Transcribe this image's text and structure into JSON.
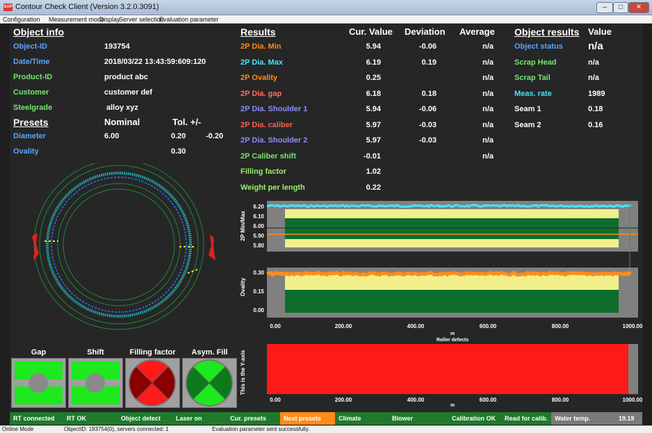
{
  "window": {
    "title": "Contour Check Client (Version 3.2.0.3091)",
    "icon_label": "SAP"
  },
  "menu": [
    "Configuration",
    "Measurement mode",
    "Display",
    "Server selection",
    "Evaluation parameter"
  ],
  "object_info": {
    "heading": "Object info",
    "rows": [
      {
        "label": "Object-ID",
        "value": "193754"
      },
      {
        "label": "Date/Time",
        "value": "2018/03/22 13:43:59:609:120"
      },
      {
        "label": "Product-ID",
        "value": "product abc"
      },
      {
        "label": "Customer",
        "value": "customer def"
      },
      {
        "label": "Steelgrade",
        "value": "alloy xyz"
      }
    ]
  },
  "presets": {
    "heading": "Presets",
    "nominal_label": "Nominal",
    "tol_label": "Tol. +/-",
    "rows": [
      {
        "label": "Diameter",
        "nominal": "6.00",
        "tol_plus": "0.20",
        "tol_minus": "-0.20"
      },
      {
        "label": "Ovality",
        "nominal": "",
        "tol_plus": "0.30",
        "tol_minus": ""
      }
    ]
  },
  "results": {
    "heading": "Results",
    "col_cur": "Cur. Value",
    "col_dev": "Deviation",
    "col_avg": "Average",
    "rows": [
      {
        "label": "2P Dia. Min",
        "cur": "5.94",
        "dev": "-0.06",
        "avg": "n/a",
        "color": "#ff8c1a"
      },
      {
        "label": "2P Dia. Max",
        "cur": "6.19",
        "dev": "0.19",
        "avg": "n/a",
        "color": "#44e6ff"
      },
      {
        "label": "2P Ovality",
        "cur": "0.25",
        "dev": "",
        "avg": "n/a",
        "color": "#ff8c1a"
      },
      {
        "label": "2P Dia. gap",
        "cur": "6.18",
        "dev": "0.18",
        "avg": "n/a",
        "color": "#ff6f5e"
      },
      {
        "label": "2P Dia. Shoulder 1",
        "cur": "5.94",
        "dev": "-0.06",
        "avg": "n/a",
        "color": "#8c8cff"
      },
      {
        "label": "2P Dia. caliber",
        "cur": "5.97",
        "dev": "-0.03",
        "avg": "n/a",
        "color": "#ff5f4a"
      },
      {
        "label": "2P Dia. Shoulder 2",
        "cur": "5.97",
        "dev": "-0.03",
        "avg": "n/a",
        "color": "#8c8cff"
      },
      {
        "label": "2P Caliber shift",
        "cur": "-0.01",
        "dev": "",
        "avg": "n/a",
        "color": "#74e66e"
      },
      {
        "label": "Filling factor",
        "cur": "1.02",
        "dev": "",
        "avg": "",
        "color": "#9cef6e"
      },
      {
        "label": "Weight per length",
        "cur": "0.22",
        "dev": "",
        "avg": "",
        "color": "#9cef6e"
      }
    ]
  },
  "object_results": {
    "heading": "Object results",
    "col_value": "Value",
    "rows": [
      {
        "label": "Object status",
        "value": "n/a",
        "color": "#5aa6ff"
      },
      {
        "label": "Scrap Head",
        "value": "n/a",
        "color": "#74e66e"
      },
      {
        "label": "Scrap Tail",
        "value": "n/a",
        "color": "#74e66e"
      },
      {
        "label": "Meas. rate",
        "value": "1989",
        "color": "#44e6ff"
      },
      {
        "label": "Seam 1",
        "value": "0.18",
        "color": "#ffffff"
      },
      {
        "label": "Seam 2",
        "value": "0.16",
        "color": "#ffffff"
      }
    ]
  },
  "gauges": [
    {
      "label": "Gap",
      "state": "ok"
    },
    {
      "label": "Shift",
      "state": "ok"
    },
    {
      "label": "Filling factor",
      "state": "alarm"
    },
    {
      "label": "Asym. Fill",
      "state": "ok"
    }
  ],
  "charts": {
    "dia": {
      "ylabel": "2P Min/Max",
      "ticks": [
        "6.20",
        "6.10",
        "6.00",
        "5.90",
        "5.80"
      ]
    },
    "ovality": {
      "ylabel": "Ovality",
      "ticks": [
        "0.30",
        "0.15",
        "0.00"
      ]
    },
    "x_ticks": [
      "0.00",
      "200.00",
      "400.00",
      "600.00",
      "800.00",
      "1000.00"
    ],
    "x_unit": "m",
    "roller": {
      "title": "Roller defects",
      "ylabel": "This is the Y-axis",
      "x_ticks": [
        "0.00",
        "200.00",
        "400.00",
        "600.00",
        "800.00",
        "1000.00"
      ],
      "x_unit": "m"
    }
  },
  "chart_data": [
    {
      "type": "line",
      "title": "",
      "xlabel": "m",
      "ylabel": "2P Min/Max",
      "xlim": [
        0,
        1000
      ],
      "ylim": [
        5.75,
        6.25
      ],
      "series": [
        {
          "name": "2P Dia. Max",
          "values": [
            6.2,
            6.2
          ]
        },
        {
          "name": "2P Dia. Min",
          "values": [
            5.95,
            5.95
          ]
        }
      ],
      "x": [
        0,
        1000
      ],
      "nominal": 6.0,
      "tolerance_band": [
        5.8,
        6.2
      ]
    },
    {
      "type": "line",
      "title": "",
      "xlabel": "m",
      "ylabel": "Ovality",
      "xlim": [
        0,
        1000
      ],
      "ylim": [
        -0.05,
        0.35
      ],
      "series": [
        {
          "name": "2P Ovality",
          "values": [
            0.3,
            0.3
          ]
        }
      ],
      "x": [
        0,
        1000
      ],
      "tolerance_band": [
        0.0,
        0.3
      ]
    },
    {
      "type": "area",
      "title": "Roller defects",
      "xlabel": "m",
      "ylabel": "This is the Y-axis",
      "xlim": [
        0,
        1000
      ]
    }
  ],
  "status": [
    {
      "label": "RT connected",
      "color": "#1f7a2b"
    },
    {
      "label": "RT OK",
      "color": "#1f7a2b"
    },
    {
      "label": "Object detect",
      "color": "#1f7a2b"
    },
    {
      "label": "Laser on",
      "color": "#1f7a2b"
    },
    {
      "label": "Cur. presets",
      "color": "#1f7a2b"
    },
    {
      "label": "Next presets",
      "color": "#ff8c1a"
    },
    {
      "label": "Climate",
      "color": "#1f7a2b"
    },
    {
      "label": "Blower",
      "color": "#1f7a2b"
    },
    {
      "label": "Calibration OK",
      "color": "#1f7a2b"
    },
    {
      "label": "Read for calib.",
      "color": "#1f7a2b"
    },
    {
      "label": "Water temp.",
      "color": "#7a7a7a"
    },
    {
      "label": "19.19",
      "color": "#7a7a7a"
    }
  ],
  "bottom": {
    "mode": "Online Mode",
    "object": "ObjectID: 193754(0), servers connected: 1",
    "message": "Evaluation parameter sent successfully."
  }
}
